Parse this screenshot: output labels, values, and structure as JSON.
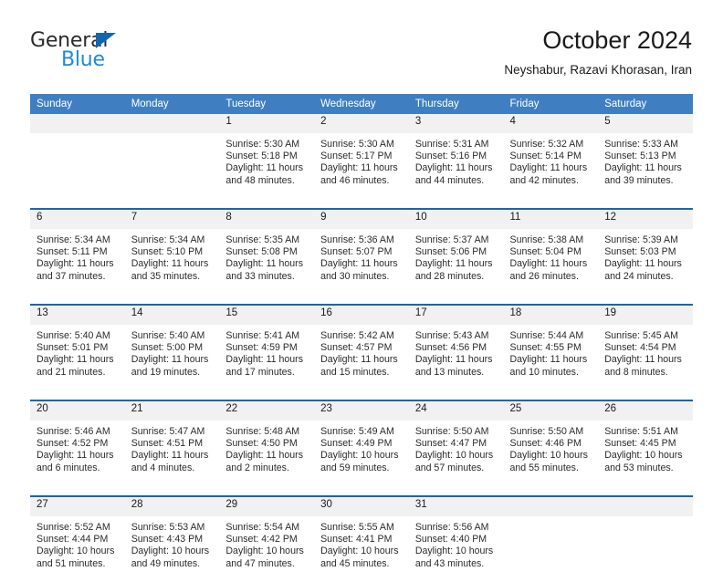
{
  "brand": {
    "name_dark": "General",
    "name_blue": "Blue",
    "triangle_icon": "triangle-icon",
    "color_dark": "#2b2b2b",
    "color_blue": "#1f8ad8",
    "color_triangle": "#1266b0"
  },
  "header": {
    "title": "October 2024",
    "subtitle": "Neyshabur, Razavi Khorasan, Iran"
  },
  "theme": {
    "header_blue": "#3f7fc1",
    "separator_blue": "#1667ad",
    "daynum_band": "#f1f1f1",
    "text": "#2b2b2b"
  },
  "weekdays": [
    "Sunday",
    "Monday",
    "Tuesday",
    "Wednesday",
    "Thursday",
    "Friday",
    "Saturday"
  ],
  "weeks": [
    [
      {
        "day": "",
        "lines": []
      },
      {
        "day": "",
        "lines": []
      },
      {
        "day": "1",
        "lines": [
          "Sunrise: 5:30 AM",
          "Sunset: 5:18 PM",
          "Daylight: 11 hours",
          "and 48 minutes."
        ]
      },
      {
        "day": "2",
        "lines": [
          "Sunrise: 5:30 AM",
          "Sunset: 5:17 PM",
          "Daylight: 11 hours",
          "and 46 minutes."
        ]
      },
      {
        "day": "3",
        "lines": [
          "Sunrise: 5:31 AM",
          "Sunset: 5:16 PM",
          "Daylight: 11 hours",
          "and 44 minutes."
        ]
      },
      {
        "day": "4",
        "lines": [
          "Sunrise: 5:32 AM",
          "Sunset: 5:14 PM",
          "Daylight: 11 hours",
          "and 42 minutes."
        ]
      },
      {
        "day": "5",
        "lines": [
          "Sunrise: 5:33 AM",
          "Sunset: 5:13 PM",
          "Daylight: 11 hours",
          "and 39 minutes."
        ]
      }
    ],
    [
      {
        "day": "6",
        "lines": [
          "Sunrise: 5:34 AM",
          "Sunset: 5:11 PM",
          "Daylight: 11 hours",
          "and 37 minutes."
        ]
      },
      {
        "day": "7",
        "lines": [
          "Sunrise: 5:34 AM",
          "Sunset: 5:10 PM",
          "Daylight: 11 hours",
          "and 35 minutes."
        ]
      },
      {
        "day": "8",
        "lines": [
          "Sunrise: 5:35 AM",
          "Sunset: 5:08 PM",
          "Daylight: 11 hours",
          "and 33 minutes."
        ]
      },
      {
        "day": "9",
        "lines": [
          "Sunrise: 5:36 AM",
          "Sunset: 5:07 PM",
          "Daylight: 11 hours",
          "and 30 minutes."
        ]
      },
      {
        "day": "10",
        "lines": [
          "Sunrise: 5:37 AM",
          "Sunset: 5:06 PM",
          "Daylight: 11 hours",
          "and 28 minutes."
        ]
      },
      {
        "day": "11",
        "lines": [
          "Sunrise: 5:38 AM",
          "Sunset: 5:04 PM",
          "Daylight: 11 hours",
          "and 26 minutes."
        ]
      },
      {
        "day": "12",
        "lines": [
          "Sunrise: 5:39 AM",
          "Sunset: 5:03 PM",
          "Daylight: 11 hours",
          "and 24 minutes."
        ]
      }
    ],
    [
      {
        "day": "13",
        "lines": [
          "Sunrise: 5:40 AM",
          "Sunset: 5:01 PM",
          "Daylight: 11 hours",
          "and 21 minutes."
        ]
      },
      {
        "day": "14",
        "lines": [
          "Sunrise: 5:40 AM",
          "Sunset: 5:00 PM",
          "Daylight: 11 hours",
          "and 19 minutes."
        ]
      },
      {
        "day": "15",
        "lines": [
          "Sunrise: 5:41 AM",
          "Sunset: 4:59 PM",
          "Daylight: 11 hours",
          "and 17 minutes."
        ]
      },
      {
        "day": "16",
        "lines": [
          "Sunrise: 5:42 AM",
          "Sunset: 4:57 PM",
          "Daylight: 11 hours",
          "and 15 minutes."
        ]
      },
      {
        "day": "17",
        "lines": [
          "Sunrise: 5:43 AM",
          "Sunset: 4:56 PM",
          "Daylight: 11 hours",
          "and 13 minutes."
        ]
      },
      {
        "day": "18",
        "lines": [
          "Sunrise: 5:44 AM",
          "Sunset: 4:55 PM",
          "Daylight: 11 hours",
          "and 10 minutes."
        ]
      },
      {
        "day": "19",
        "lines": [
          "Sunrise: 5:45 AM",
          "Sunset: 4:54 PM",
          "Daylight: 11 hours",
          "and 8 minutes."
        ]
      }
    ],
    [
      {
        "day": "20",
        "lines": [
          "Sunrise: 5:46 AM",
          "Sunset: 4:52 PM",
          "Daylight: 11 hours",
          "and 6 minutes."
        ]
      },
      {
        "day": "21",
        "lines": [
          "Sunrise: 5:47 AM",
          "Sunset: 4:51 PM",
          "Daylight: 11 hours",
          "and 4 minutes."
        ]
      },
      {
        "day": "22",
        "lines": [
          "Sunrise: 5:48 AM",
          "Sunset: 4:50 PM",
          "Daylight: 11 hours",
          "and 2 minutes."
        ]
      },
      {
        "day": "23",
        "lines": [
          "Sunrise: 5:49 AM",
          "Sunset: 4:49 PM",
          "Daylight: 10 hours",
          "and 59 minutes."
        ]
      },
      {
        "day": "24",
        "lines": [
          "Sunrise: 5:50 AM",
          "Sunset: 4:47 PM",
          "Daylight: 10 hours",
          "and 57 minutes."
        ]
      },
      {
        "day": "25",
        "lines": [
          "Sunrise: 5:50 AM",
          "Sunset: 4:46 PM",
          "Daylight: 10 hours",
          "and 55 minutes."
        ]
      },
      {
        "day": "26",
        "lines": [
          "Sunrise: 5:51 AM",
          "Sunset: 4:45 PM",
          "Daylight: 10 hours",
          "and 53 minutes."
        ]
      }
    ],
    [
      {
        "day": "27",
        "lines": [
          "Sunrise: 5:52 AM",
          "Sunset: 4:44 PM",
          "Daylight: 10 hours",
          "and 51 minutes."
        ]
      },
      {
        "day": "28",
        "lines": [
          "Sunrise: 5:53 AM",
          "Sunset: 4:43 PM",
          "Daylight: 10 hours",
          "and 49 minutes."
        ]
      },
      {
        "day": "29",
        "lines": [
          "Sunrise: 5:54 AM",
          "Sunset: 4:42 PM",
          "Daylight: 10 hours",
          "and 47 minutes."
        ]
      },
      {
        "day": "30",
        "lines": [
          "Sunrise: 5:55 AM",
          "Sunset: 4:41 PM",
          "Daylight: 10 hours",
          "and 45 minutes."
        ]
      },
      {
        "day": "31",
        "lines": [
          "Sunrise: 5:56 AM",
          "Sunset: 4:40 PM",
          "Daylight: 10 hours",
          "and 43 minutes."
        ]
      },
      {
        "day": "",
        "lines": []
      },
      {
        "day": "",
        "lines": []
      }
    ]
  ]
}
